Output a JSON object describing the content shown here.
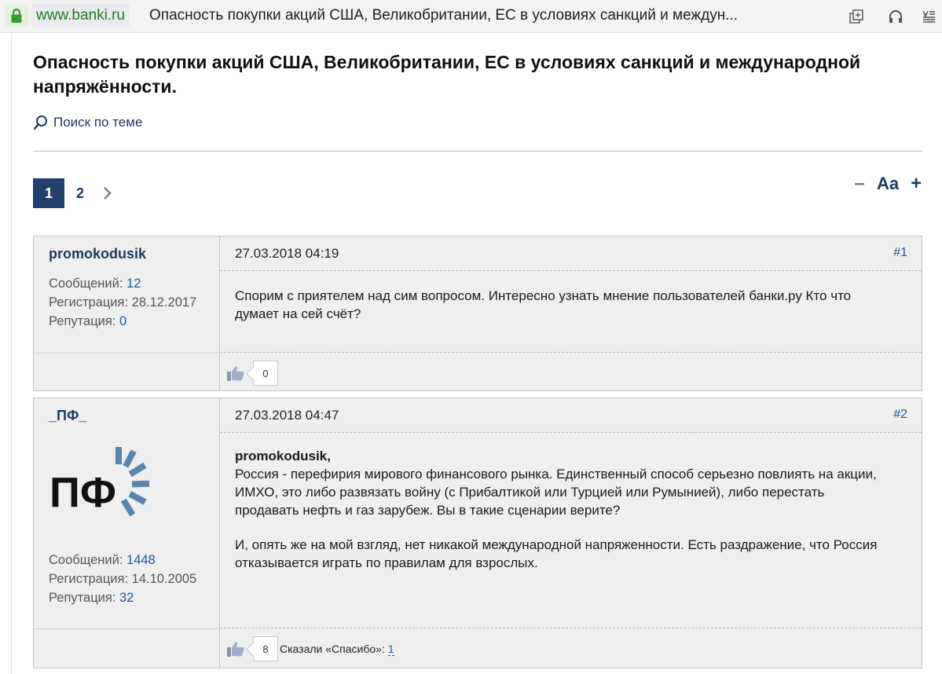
{
  "browser": {
    "url": "www.banki.ru",
    "tab_title": "Опасность покупки акций США, Великобритании, ЕС в условиях санкций и междун..."
  },
  "topic": {
    "title": "Опасность покупки акций США, Великобритании, ЕС в условиях санкций и международной напряжённости.",
    "search_label": "Поиск по теме"
  },
  "pagination": {
    "pages": [
      "1",
      "2"
    ],
    "current": "1"
  },
  "font_controls": {
    "minus": "–",
    "label": "Aa",
    "plus": "+"
  },
  "labels": {
    "messages": "Сообщений:",
    "registration": "Регистрация:",
    "reputation": "Репутация:",
    "thanks": "Сказали «Спасибо»:"
  },
  "posts": [
    {
      "username": "promokodusik",
      "messages": "12",
      "registration": "28.12.2017",
      "reputation": "0",
      "date": "27.03.2018 04:19",
      "number": "#1",
      "paragraphs": [
        "Спорим с приятелем над сим вопросом. Интересно узнать мнение пользователей банки.ру Кто что думает на сей счёт?"
      ],
      "likes": "0"
    },
    {
      "username": "_ПФ_",
      "avatar_text": "ПФ",
      "messages": "1448",
      "registration": "14.10.2005",
      "reputation": "32",
      "date": "27.03.2018 04:47",
      "number": "#2",
      "quote_author": "promokodusik,",
      "paragraphs": [
        "Россия - перефирия мирового финансового рынка. Единственный способ серьезно повлиять на акции, ИМХО, это либо развязать войну (с Прибалтикой или Турцией или Румынией), либо перестать продавать нефть и газ зарубеж. Вы в такие сценарии верите?",
        "И, опять же на мой взгляд, нет никакой международной напряженности. Есть раздражение, что Россия отказывается играть по правилам для взрослых."
      ],
      "likes": "8",
      "thanks_count": "1"
    }
  ],
  "icons": {
    "lock": "lock-icon",
    "search": "search-icon",
    "next": "chevron-right-icon",
    "like": "thumbs-up-icon",
    "window": "popout-window-icon",
    "audio": "headphones-icon",
    "reader": "reader-mode-icon"
  },
  "colors": {
    "accent": "#22406e",
    "link": "#1b5aa8",
    "url_green": "#1e7a1e"
  }
}
